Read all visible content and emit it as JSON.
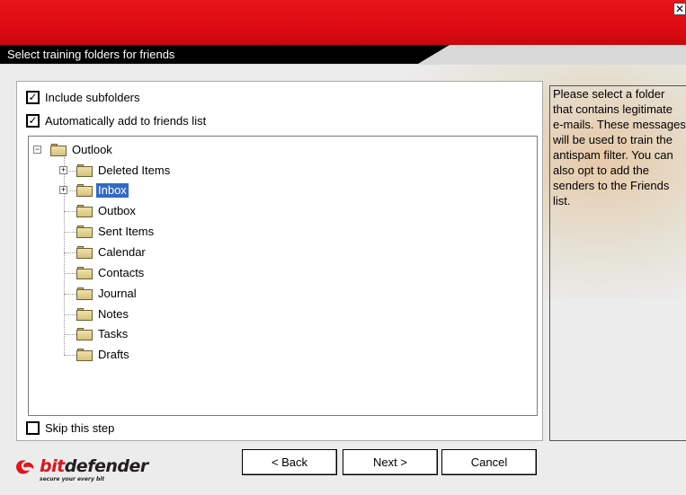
{
  "window": {
    "close_glyph": "✕",
    "header_title": "Select training folders for friends"
  },
  "options": {
    "include_subfolders": {
      "label": "Include subfolders",
      "checked": true
    },
    "auto_add_friends": {
      "label": "Automatically add to friends list",
      "checked": true
    },
    "skip_step": {
      "label": "Skip this step",
      "checked": false
    }
  },
  "tree": {
    "root": "Outlook",
    "items": [
      {
        "label": "Deleted Items",
        "expandable": true,
        "selected": false
      },
      {
        "label": "Inbox",
        "expandable": true,
        "selected": true
      },
      {
        "label": "Outbox",
        "expandable": false,
        "selected": false
      },
      {
        "label": "Sent Items",
        "expandable": false,
        "selected": false
      },
      {
        "label": "Calendar",
        "expandable": false,
        "selected": false
      },
      {
        "label": "Contacts",
        "expandable": false,
        "selected": false
      },
      {
        "label": "Journal",
        "expandable": false,
        "selected": false
      },
      {
        "label": "Notes",
        "expandable": false,
        "selected": false
      },
      {
        "label": "Tasks",
        "expandable": false,
        "selected": false
      },
      {
        "label": "Drafts",
        "expandable": false,
        "selected": false
      }
    ]
  },
  "help": {
    "text": "Please select a folder that contains legitimate e-mails. These messages will be used to train the antispam filter. You can also opt to add the senders to the Friends list."
  },
  "brand": {
    "name_part1": "bit",
    "name_part2": "defender",
    "tagline": "secure your every bit"
  },
  "buttons": {
    "back": "< Back",
    "next": "Next >",
    "cancel": "Cancel"
  },
  "colors": {
    "brand_red": "#e0151b",
    "selection": "#316ac5"
  },
  "icons": {
    "folder": "folder-icon",
    "close": "close-icon",
    "logo": "bitdefender-logo-icon"
  }
}
